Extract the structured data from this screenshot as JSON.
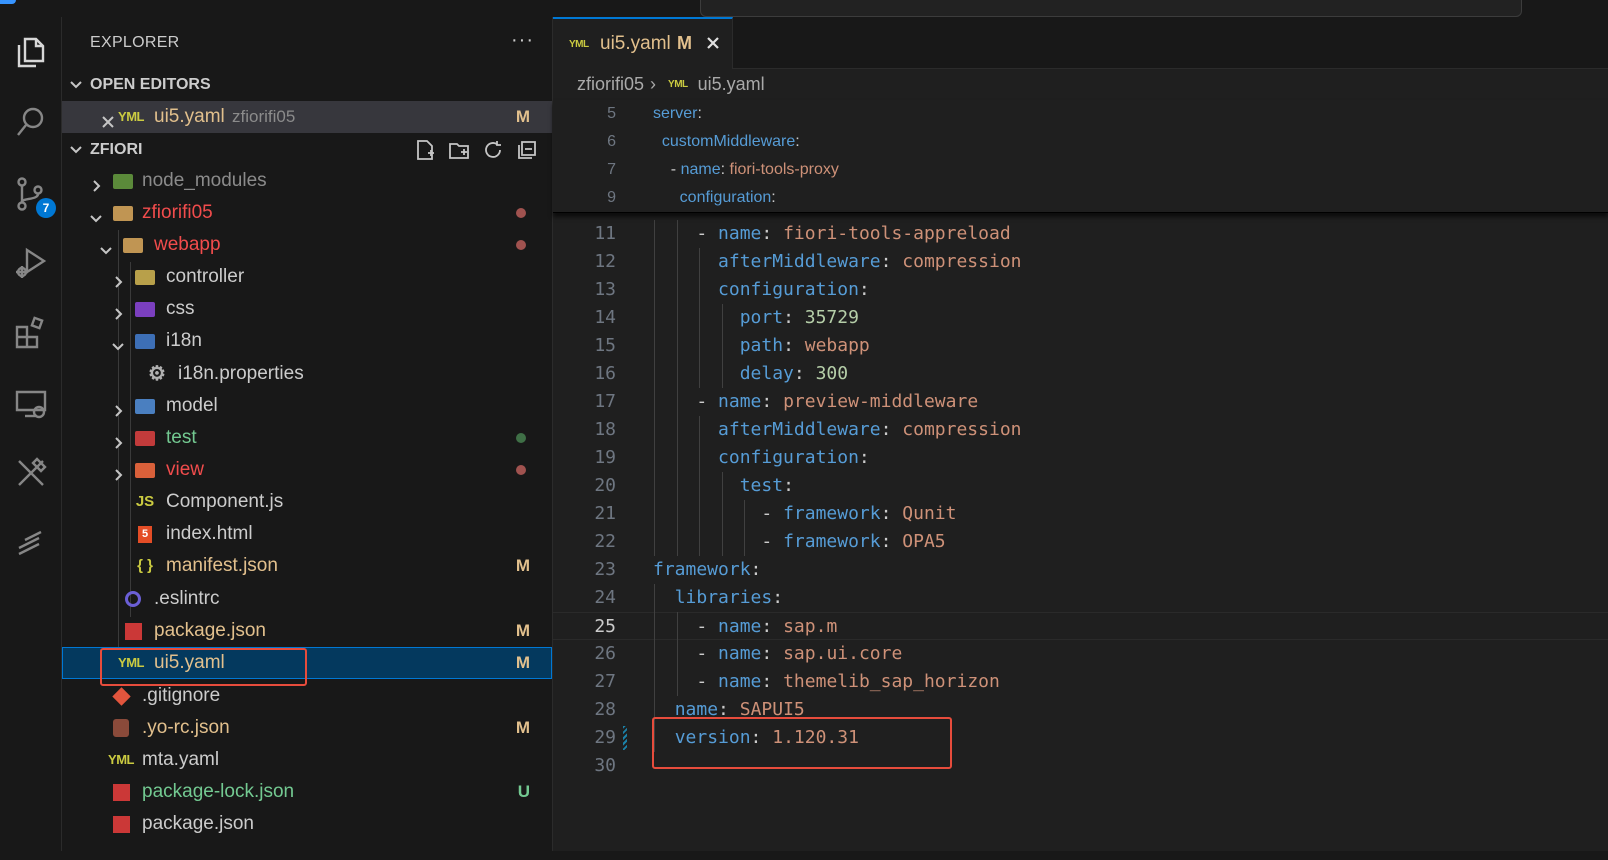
{
  "explorer": {
    "title": "EXPLORER",
    "more": "···",
    "open_editors": {
      "label": "OPEN EDITORS",
      "items": [
        {
          "name": "ui5.yaml",
          "folder": "zfiorifi05",
          "status": "M"
        }
      ]
    },
    "workspace": {
      "label": "ZFIORI",
      "items": [
        {
          "name": "node_modules"
        },
        {
          "name": "zfiorifi05"
        },
        {
          "name": "webapp"
        },
        {
          "name": "controller"
        },
        {
          "name": "css"
        },
        {
          "name": "i18n"
        },
        {
          "name": "i18n.properties"
        },
        {
          "name": "model"
        },
        {
          "name": "test"
        },
        {
          "name": "view"
        },
        {
          "name": "Component.js"
        },
        {
          "name": "index.html"
        },
        {
          "name": "manifest.json",
          "status": "M"
        },
        {
          "name": ".eslintrc"
        },
        {
          "name": "package.json",
          "status": "M"
        },
        {
          "name": "ui5.yaml",
          "status": "M"
        },
        {
          "name": ".gitignore"
        },
        {
          "name": ".yo-rc.json",
          "status": "M"
        },
        {
          "name": "mta.yaml"
        },
        {
          "name": "package-lock.json",
          "status": "U"
        },
        {
          "name": "package.json"
        }
      ]
    }
  },
  "activity_bar": {
    "icons": [
      "explorer-icon",
      "search-icon",
      "source-control-icon",
      "run-debug-icon",
      "extensions-icon",
      "remote-explorer-icon",
      "sap-tools-icon",
      "fiori-icon"
    ],
    "scm_badge": "7"
  },
  "editor": {
    "tab": {
      "name": "ui5.yaml",
      "status": "M"
    },
    "breadcrumb": [
      "zfiorifi05",
      "ui5.yaml"
    ],
    "sticky_lines": [
      {
        "n": "5",
        "text": "server:"
      },
      {
        "n": "6",
        "text": "  customMiddleware:"
      },
      {
        "n": "7",
        "text": "    - name: fiori-tools-proxy"
      },
      {
        "n": "9",
        "text": "      configuration:"
      }
    ],
    "lines": [
      {
        "n": "11",
        "text": "    - name: fiori-tools-appreload"
      },
      {
        "n": "12",
        "text": "      afterMiddleware: compression"
      },
      {
        "n": "13",
        "text": "      configuration:"
      },
      {
        "n": "14",
        "text": "        port: 35729"
      },
      {
        "n": "15",
        "text": "        path: webapp"
      },
      {
        "n": "16",
        "text": "        delay: 300"
      },
      {
        "n": "17",
        "text": "    - name: preview-middleware"
      },
      {
        "n": "18",
        "text": "      afterMiddleware: compression"
      },
      {
        "n": "19",
        "text": "      configuration:"
      },
      {
        "n": "20",
        "text": "        test:"
      },
      {
        "n": "21",
        "text": "          - framework: Qunit"
      },
      {
        "n": "22",
        "text": "          - framework: OPA5"
      },
      {
        "n": "23",
        "text": "framework:"
      },
      {
        "n": "24",
        "text": "  libraries:"
      },
      {
        "n": "25",
        "text": "    - name: sap.m"
      },
      {
        "n": "26",
        "text": "    - name: sap.ui.core"
      },
      {
        "n": "27",
        "text": "    - name: themelib_sap_horizon"
      },
      {
        "n": "28",
        "text": "  name: SAPUI5"
      },
      {
        "n": "29",
        "text": "  version: 1.120.31"
      },
      {
        "n": "30",
        "text": ""
      }
    ],
    "current_line": "25"
  },
  "colors": {
    "accent": "#0078d4",
    "modified": "#e2c08d",
    "error": "#f14c4c",
    "untracked": "#73c991",
    "highlight_box": "#e74c3c"
  }
}
